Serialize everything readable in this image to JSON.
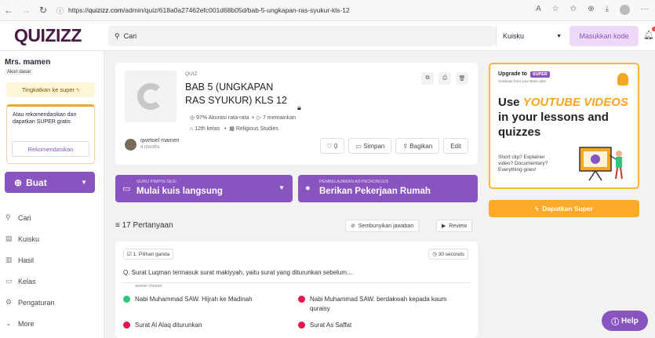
{
  "browser": {
    "url_prefix": "https://",
    "url_host": "quizizz.com",
    "url_path": "/admin/quiz/618a0a27462efc001d68b05d/bab-5-ungkapan-ras-syukur-kls-12"
  },
  "app": {
    "logo": "QUIZIZZ",
    "search_placeholder": "Cari",
    "my_library": "Kuisku",
    "enter_code": "Masukkan kode"
  },
  "sidebar": {
    "user_name": "Mrs. mamen",
    "account_type": "Akun dasar",
    "upgrade_label": "Tingkatkan ke super",
    "reco_text": "Atau rekomendasikan dan dapatkan SUPER gratis",
    "reco_button": "Rekomendasikan",
    "create_label": "Buat",
    "items": [
      {
        "label": "Cari",
        "icon": "search-icon"
      },
      {
        "label": "Kuisku",
        "icon": "library-icon"
      },
      {
        "label": "Hasil",
        "icon": "chart-icon"
      },
      {
        "label": "Kelas",
        "icon": "class-icon"
      },
      {
        "label": "Pengaturan",
        "icon": "gear-icon"
      },
      {
        "label": "More",
        "icon": "chevron-down-icon"
      }
    ]
  },
  "quiz": {
    "label": "QUIZ",
    "title": "BAB 5 (UNGKAPAN RAS SYUKUR) KLS 12",
    "accuracy": "97% Akurasi rata-rata",
    "plays": "7 memainkan",
    "grade": "12th kelas",
    "subject": "Religious Studies",
    "author": "qwetoel mamen",
    "author_time": "4 months",
    "likes": "0",
    "save": "Simpan",
    "share": "Bagikan",
    "edit": "Edit"
  },
  "live": {
    "small": "GURU PIMPIN SESI",
    "big": "Mulai kuis langsung"
  },
  "homework": {
    "small": "PEMBELAJARAN ASYNCRONOUS",
    "big": "Berikan Pekerjaan Rumah"
  },
  "questions": {
    "count_label": "17 Pertanyaan",
    "hide_answers": "Sembunyikan jawaban",
    "review": "Review",
    "q1": {
      "type": "1. Pilihan ganda",
      "time": "30 seconds",
      "text": "Q. Surat Luqman termasuk surat makiyyah, yaitu surat yang diturunkan sebelum....",
      "answer_choices_label": "answer choices",
      "answers": [
        {
          "text": "Nabi Muhammad SAW. Hijrah ke Madinah",
          "color": "#2ec57e"
        },
        {
          "text": "Nabi Muhammad SAW. berdakwah kepada kaum quraisy",
          "color": "#e5174a"
        },
        {
          "text": "Surat Al Alaq diturunkan",
          "color": "#e5174a"
        },
        {
          "text": "Surat As Saffat",
          "color": "#e5174a"
        }
      ]
    }
  },
  "promo": {
    "upgrade_to": "Upgrade to",
    "super_badge": "SUPER",
    "graduate": "Graduate from your Basic plan",
    "headline_pre": "Use ",
    "headline_em": "YOUTUBE VIDEOS",
    "headline_post": " in your lessons and quizzes",
    "sub": "Short clip? Explainer video? Documentary? Everything goes!",
    "cta": "Dapatkan Super"
  },
  "help_label": "Help",
  "colors": {
    "primary": "#8854c0",
    "accent": "#ffa92b",
    "logo": "#461a42"
  }
}
